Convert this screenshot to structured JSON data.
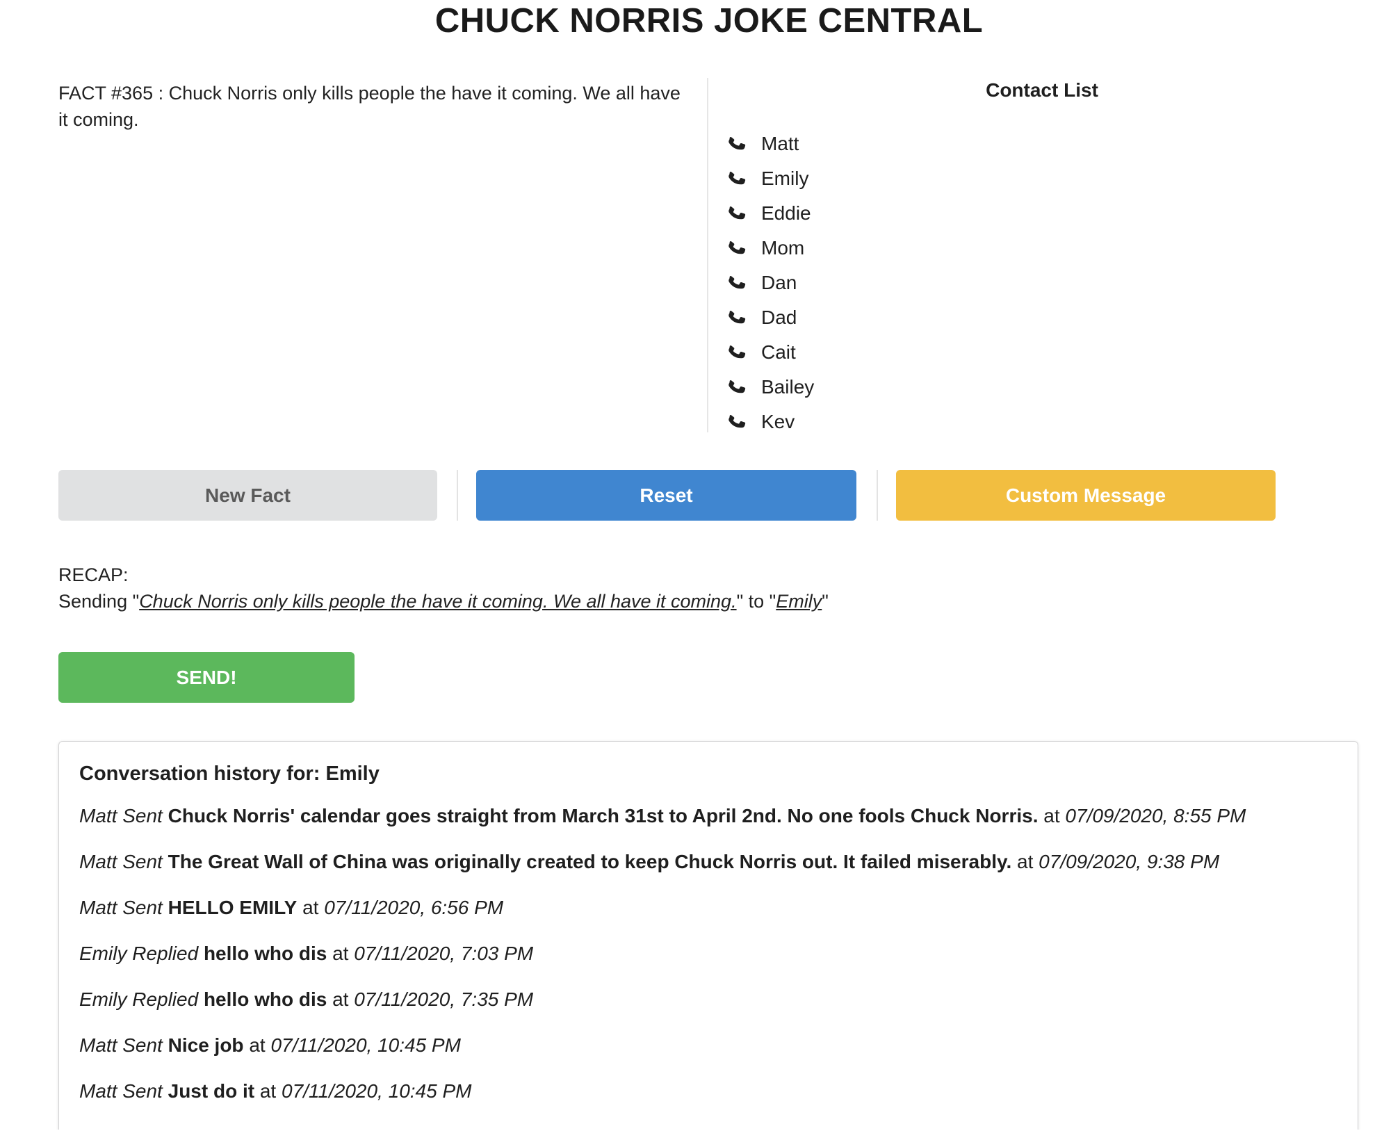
{
  "header": {
    "title": "CHUCK NORRIS JOKE CENTRAL"
  },
  "fact": {
    "text": "FACT #365 : Chuck Norris only kills people the have it coming. We all have it coming."
  },
  "contacts": {
    "title": "Contact List",
    "icon": "phone-icon",
    "items": [
      "Matt",
      "Emily",
      "Eddie",
      "Mom",
      "Dan",
      "Dad",
      "Cait",
      "Bailey",
      "Kev"
    ]
  },
  "buttons": {
    "new_fact": "New Fact",
    "reset": "Reset",
    "custom_message": "Custom Message",
    "send": "SEND!"
  },
  "colors": {
    "new_fact": "#e0e1e2",
    "reset": "#4086d0",
    "custom_message": "#f2be40",
    "send": "#5cb85c"
  },
  "recap": {
    "label": "RECAP:",
    "prefix": "Sending \"",
    "message": "Chuck Norris only kills people the have it coming. We all have it coming.",
    "middle": "\" to \"",
    "recipient": "Emily",
    "suffix": "\""
  },
  "history": {
    "title": "Conversation history for: Emily",
    "messages": [
      {
        "who": "Matt Sent",
        "text": "Chuck Norris' calendar goes straight from March 31st to April 2nd. No one fools Chuck Norris.",
        "at": "at",
        "when": "07/09/2020, 8:55 PM"
      },
      {
        "who": "Matt Sent",
        "text": "The Great Wall of China was originally created to keep Chuck Norris out. It failed miserably.",
        "at": "at",
        "when": "07/09/2020, 9:38 PM"
      },
      {
        "who": "Matt Sent",
        "text": "HELLO EMILY",
        "at": "at",
        "when": "07/11/2020, 6:56 PM"
      },
      {
        "who": "Emily Replied",
        "text": "hello who dis",
        "at": "at",
        "when": "07/11/2020, 7:03 PM"
      },
      {
        "who": "Emily Replied",
        "text": "hello who dis",
        "at": "at",
        "when": "07/11/2020, 7:35 PM"
      },
      {
        "who": "Matt Sent",
        "text": "Nice job",
        "at": "at",
        "when": "07/11/2020, 10:45 PM"
      },
      {
        "who": "Matt Sent",
        "text": "Just do it",
        "at": "at",
        "when": "07/11/2020, 10:45 PM"
      }
    ]
  }
}
